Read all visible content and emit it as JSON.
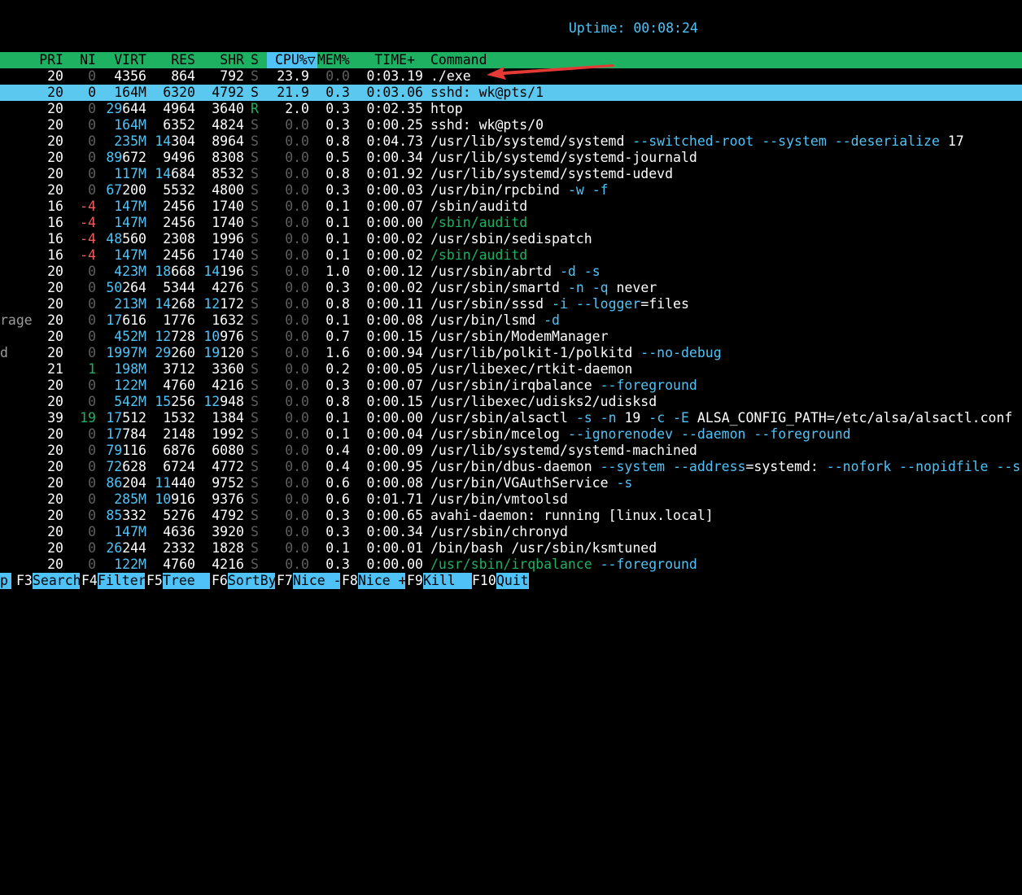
{
  "uptime": {
    "label": "Uptime:",
    "value": "00:08:24"
  },
  "header": {
    "pri": "PRI",
    "ni": "NI",
    "virt": "VIRT",
    "res": "RES",
    "shr": "SHR",
    "s": "S",
    "cpu": "CPU%▽",
    "mem": "MEM%",
    "time": "TIME+",
    "command": "Command"
  },
  "left_fragments": [
    "rage",
    "d"
  ],
  "processes": [
    {
      "pri": "20",
      "ni": "0",
      "virt": "4356",
      "res": "864",
      "shr": "792",
      "s": "S",
      "cpu": "23.9",
      "mem": "0.0",
      "time": "0:03.19",
      "cmd": "./exe"
    },
    {
      "pri": "20",
      "ni": "0",
      "virt": "164M",
      "res": "6320",
      "shr": "4792",
      "s": "S",
      "cpu": "21.9",
      "mem": "0.3",
      "time": "0:03.06",
      "cmd": "sshd: wk@pts/1"
    },
    {
      "pri": "20",
      "ni": "0",
      "virt": "29644",
      "res": "4964",
      "shr": "3640",
      "s": "R",
      "cpu": "2.0",
      "mem": "0.3",
      "time": "0:02.35",
      "cmd": "htop"
    },
    {
      "pri": "20",
      "ni": "0",
      "virt": "164M",
      "res": "6352",
      "shr": "4824",
      "s": "S",
      "cpu": "0.0",
      "mem": "0.3",
      "time": "0:00.25",
      "cmd": "sshd: wk@pts/0"
    },
    {
      "pri": "20",
      "ni": "0",
      "virt": "235M",
      "res": "14304",
      "shr": "8964",
      "s": "S",
      "cpu": "0.0",
      "mem": "0.8",
      "time": "0:04.73",
      "cmd": "/usr/lib/systemd/systemd --switched-root --system --deserialize 17"
    },
    {
      "pri": "20",
      "ni": "0",
      "virt": "89672",
      "res": "9496",
      "shr": "8308",
      "s": "S",
      "cpu": "0.0",
      "mem": "0.5",
      "time": "0:00.34",
      "cmd": "/usr/lib/systemd/systemd-journald"
    },
    {
      "pri": "20",
      "ni": "0",
      "virt": "117M",
      "res": "14684",
      "shr": "8532",
      "s": "S",
      "cpu": "0.0",
      "mem": "0.8",
      "time": "0:01.92",
      "cmd": "/usr/lib/systemd/systemd-udevd"
    },
    {
      "pri": "20",
      "ni": "0",
      "virt": "67200",
      "res": "5532",
      "shr": "4800",
      "s": "S",
      "cpu": "0.0",
      "mem": "0.3",
      "time": "0:00.03",
      "cmd": "/usr/bin/rpcbind -w -f"
    },
    {
      "pri": "16",
      "ni": "-4",
      "virt": "147M",
      "res": "2456",
      "shr": "1740",
      "s": "S",
      "cpu": "0.0",
      "mem": "0.1",
      "time": "0:00.07",
      "cmd": "/sbin/auditd"
    },
    {
      "pri": "16",
      "ni": "-4",
      "virt": "147M",
      "res": "2456",
      "shr": "1740",
      "s": "S",
      "cpu": "0.0",
      "mem": "0.1",
      "time": "0:00.00",
      "cmd": "/sbin/auditd"
    },
    {
      "pri": "16",
      "ni": "-4",
      "virt": "48560",
      "res": "2308",
      "shr": "1996",
      "s": "S",
      "cpu": "0.0",
      "mem": "0.1",
      "time": "0:00.02",
      "cmd": "/usr/sbin/sedispatch"
    },
    {
      "pri": "16",
      "ni": "-4",
      "virt": "147M",
      "res": "2456",
      "shr": "1740",
      "s": "S",
      "cpu": "0.0",
      "mem": "0.1",
      "time": "0:00.02",
      "cmd": "/sbin/auditd"
    },
    {
      "pri": "20",
      "ni": "0",
      "virt": "423M",
      "res": "18668",
      "shr": "14196",
      "s": "S",
      "cpu": "0.0",
      "mem": "1.0",
      "time": "0:00.12",
      "cmd": "/usr/sbin/abrtd -d -s"
    },
    {
      "pri": "20",
      "ni": "0",
      "virt": "50264",
      "res": "5344",
      "shr": "4276",
      "s": "S",
      "cpu": "0.0",
      "mem": "0.3",
      "time": "0:00.02",
      "cmd": "/usr/sbin/smartd -n -q never"
    },
    {
      "pri": "20",
      "ni": "0",
      "virt": "213M",
      "res": "14268",
      "shr": "12172",
      "s": "S",
      "cpu": "0.0",
      "mem": "0.8",
      "time": "0:00.11",
      "cmd": "/usr/sbin/sssd -i --logger=files"
    },
    {
      "pri": "20",
      "ni": "0",
      "virt": "17616",
      "res": "1776",
      "shr": "1632",
      "s": "S",
      "cpu": "0.0",
      "mem": "0.1",
      "time": "0:00.08",
      "cmd": "/usr/bin/lsmd -d"
    },
    {
      "pri": "20",
      "ni": "0",
      "virt": "452M",
      "res": "12728",
      "shr": "10976",
      "s": "S",
      "cpu": "0.0",
      "mem": "0.7",
      "time": "0:00.15",
      "cmd": "/usr/sbin/ModemManager"
    },
    {
      "pri": "20",
      "ni": "0",
      "virt": "1997M",
      "res": "29260",
      "shr": "19120",
      "s": "S",
      "cpu": "0.0",
      "mem": "1.6",
      "time": "0:00.94",
      "cmd": "/usr/lib/polkit-1/polkitd --no-debug"
    },
    {
      "pri": "21",
      "ni": "1",
      "virt": "198M",
      "res": "3712",
      "shr": "3360",
      "s": "S",
      "cpu": "0.0",
      "mem": "0.2",
      "time": "0:00.05",
      "cmd": "/usr/libexec/rtkit-daemon"
    },
    {
      "pri": "20",
      "ni": "0",
      "virt": "122M",
      "res": "4760",
      "shr": "4216",
      "s": "S",
      "cpu": "0.0",
      "mem": "0.3",
      "time": "0:00.07",
      "cmd": "/usr/sbin/irqbalance --foreground"
    },
    {
      "pri": "20",
      "ni": "0",
      "virt": "542M",
      "res": "15256",
      "shr": "12948",
      "s": "S",
      "cpu": "0.0",
      "mem": "0.8",
      "time": "0:00.15",
      "cmd": "/usr/libexec/udisks2/udisksd"
    },
    {
      "pri": "39",
      "ni": "19",
      "virt": "17512",
      "res": "1532",
      "shr": "1384",
      "s": "S",
      "cpu": "0.0",
      "mem": "0.1",
      "time": "0:00.00",
      "cmd": "/usr/sbin/alsactl -s -n 19 -c -E ALSA_CONFIG_PATH=/etc/alsa/alsactl.conf"
    },
    {
      "pri": "20",
      "ni": "0",
      "virt": "17784",
      "res": "2148",
      "shr": "1992",
      "s": "S",
      "cpu": "0.0",
      "mem": "0.1",
      "time": "0:00.04",
      "cmd": "/usr/sbin/mcelog --ignorenodev --daemon --foreground"
    },
    {
      "pri": "20",
      "ni": "0",
      "virt": "79116",
      "res": "6876",
      "shr": "6080",
      "s": "S",
      "cpu": "0.0",
      "mem": "0.4",
      "time": "0:00.09",
      "cmd": "/usr/lib/systemd/systemd-machined"
    },
    {
      "pri": "20",
      "ni": "0",
      "virt": "72628",
      "res": "6724",
      "shr": "4772",
      "s": "S",
      "cpu": "0.0",
      "mem": "0.4",
      "time": "0:00.95",
      "cmd": "/usr/bin/dbus-daemon --system --address=systemd: --nofork --nopidfile --s"
    },
    {
      "pri": "20",
      "ni": "0",
      "virt": "86204",
      "res": "11440",
      "shr": "9752",
      "s": "S",
      "cpu": "0.0",
      "mem": "0.6",
      "time": "0:00.08",
      "cmd": "/usr/bin/VGAuthService -s"
    },
    {
      "pri": "20",
      "ni": "0",
      "virt": "285M",
      "res": "10916",
      "shr": "9376",
      "s": "S",
      "cpu": "0.0",
      "mem": "0.6",
      "time": "0:01.71",
      "cmd": "/usr/bin/vmtoolsd"
    },
    {
      "pri": "20",
      "ni": "0",
      "virt": "85332",
      "res": "5276",
      "shr": "4792",
      "s": "S",
      "cpu": "0.0",
      "mem": "0.3",
      "time": "0:00.65",
      "cmd": "avahi-daemon: running [linux.local]"
    },
    {
      "pri": "20",
      "ni": "0",
      "virt": "147M",
      "res": "4636",
      "shr": "3920",
      "s": "S",
      "cpu": "0.0",
      "mem": "0.3",
      "time": "0:00.34",
      "cmd": "/usr/sbin/chronyd"
    },
    {
      "pri": "20",
      "ni": "0",
      "virt": "26244",
      "res": "2332",
      "shr": "1828",
      "s": "S",
      "cpu": "0.0",
      "mem": "0.1",
      "time": "0:00.01",
      "cmd": "/bin/bash /usr/sbin/ksmtuned"
    },
    {
      "pri": "20",
      "ni": "0",
      "virt": "122M",
      "res": "4760",
      "shr": "4216",
      "s": "S",
      "cpu": "0.0",
      "mem": "0.3",
      "time": "0:00.00",
      "cmd": "/usr/sbin/irqbalance --foreground"
    }
  ],
  "footer": [
    {
      "key": "",
      "label": "p"
    },
    {
      "key": "F3",
      "label": "Search"
    },
    {
      "key": "F4",
      "label": "Filter"
    },
    {
      "key": "F5",
      "label": "Tree  "
    },
    {
      "key": "F6",
      "label": "SortBy"
    },
    {
      "key": "F7",
      "label": "Nice -"
    },
    {
      "key": "F8",
      "label": "Nice +"
    },
    {
      "key": "F9",
      "label": "Kill  "
    },
    {
      "key": "F10",
      "label": "Quit"
    }
  ],
  "colors": {
    "header_bg": "#1eb162",
    "selected_bg": "#5bc8ef",
    "accent_cyan": "#4fc3f7",
    "arrow": "#e53935"
  }
}
